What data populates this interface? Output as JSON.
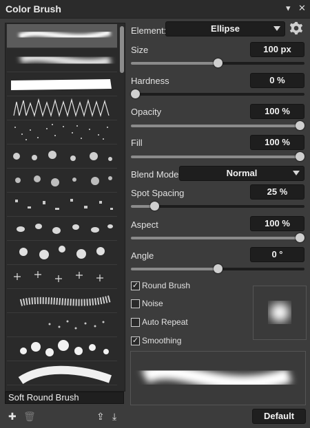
{
  "window": {
    "title": "Color Brush",
    "menu_icon": "dropdown-arrow-icon",
    "close_icon": "close-icon"
  },
  "brush_name": "Soft Round Brush",
  "element": {
    "label": "Element:",
    "value": "Ellipse"
  },
  "size": {
    "label": "Size",
    "value": "100 px",
    "level": 0.5
  },
  "hardness": {
    "label": "Hardness",
    "value": "0  %",
    "level": 0.0
  },
  "opacity": {
    "label": "Opacity",
    "value": "100  %",
    "level": 1.0
  },
  "fill": {
    "label": "Fill",
    "value": "100  %",
    "level": 1.0
  },
  "blend_mode": {
    "label": "Blend Mode:",
    "value": "Normal"
  },
  "spot_spacing": {
    "label": "Spot Spacing",
    "value": "25  %",
    "level": 0.14
  },
  "aspect": {
    "label": "Aspect",
    "value": "100  %",
    "level": 1.0
  },
  "angle": {
    "label": "Angle",
    "value": "0  °",
    "level": 0.5
  },
  "checkboxes": [
    {
      "label": "Round Brush",
      "checked": true
    },
    {
      "label": "Noise",
      "checked": false
    },
    {
      "label": "Auto Repeat",
      "checked": false
    },
    {
      "label": "Smoothing",
      "checked": true
    }
  ],
  "buttons": {
    "default_label": "Default"
  },
  "colors": {
    "panel": "#3c3c3c",
    "field": "#1e1e1e",
    "selected": "#5b5b5b"
  }
}
